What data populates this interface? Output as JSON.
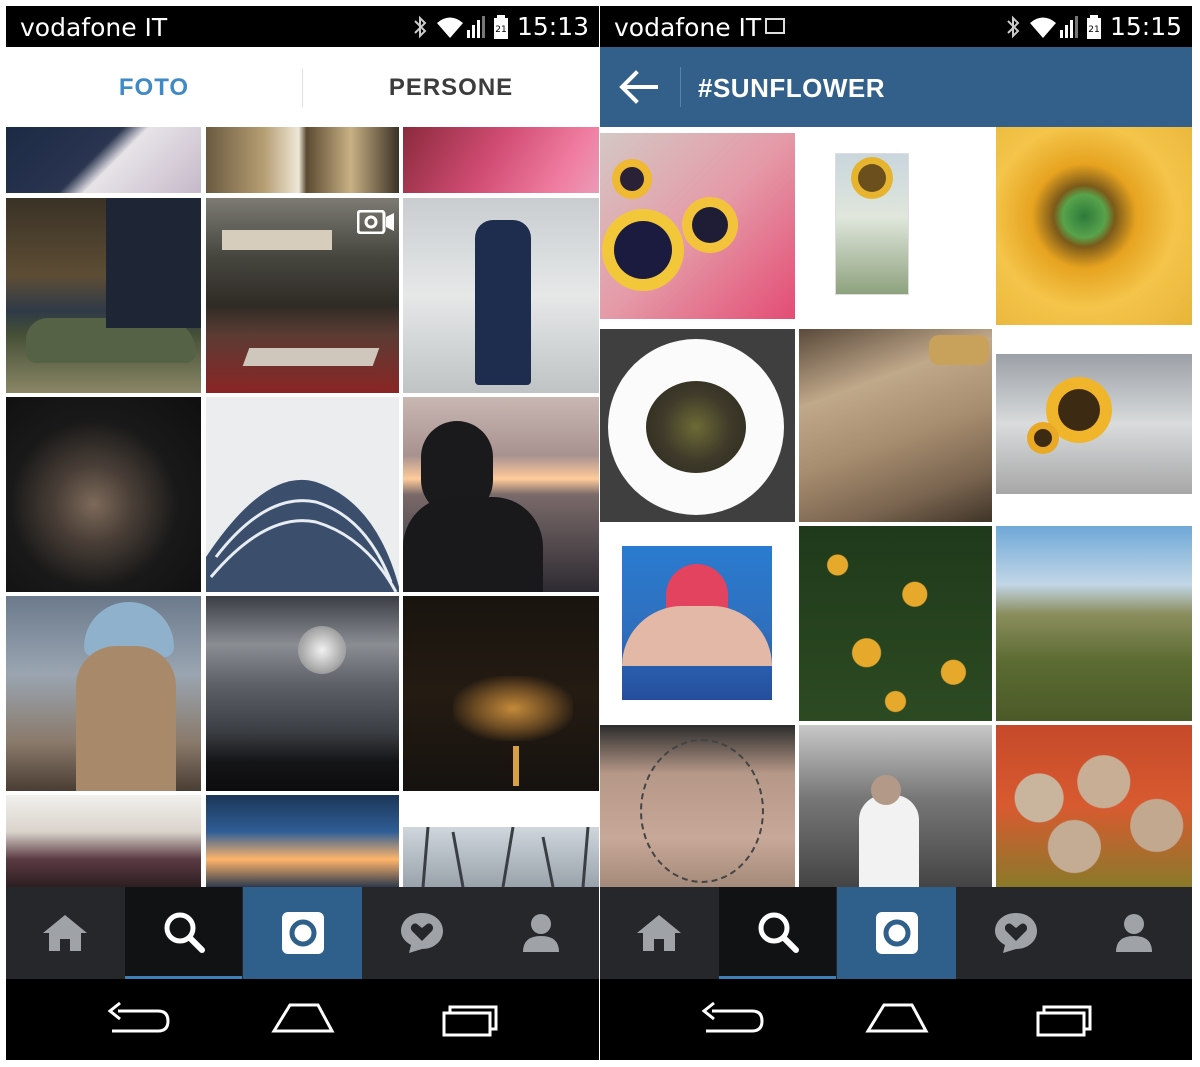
{
  "left": {
    "status": {
      "carrier": "vodafone IT",
      "time": "15:13"
    },
    "tabs": [
      {
        "label": "FOTO"
      },
      {
        "label": "PERSONE"
      }
    ],
    "photos": [
      {
        "description": "tile"
      }
    ]
  },
  "right": {
    "status": {
      "carrier": "vodafone IT",
      "time": "15:15"
    },
    "header": {
      "title": "#SUNFLOWER"
    }
  },
  "nav_icons": [
    "home-icon",
    "search-icon",
    "camera-icon",
    "activity-heart-icon",
    "profile-icon"
  ],
  "system_icons": [
    "back-icon",
    "home-outline-icon",
    "recents-icon"
  ],
  "colors": {
    "tab_active": "#3f8ac6",
    "header_blue": "#32608a",
    "nav_bg": "#25272b",
    "camera_bg": "#2f5f8b"
  }
}
